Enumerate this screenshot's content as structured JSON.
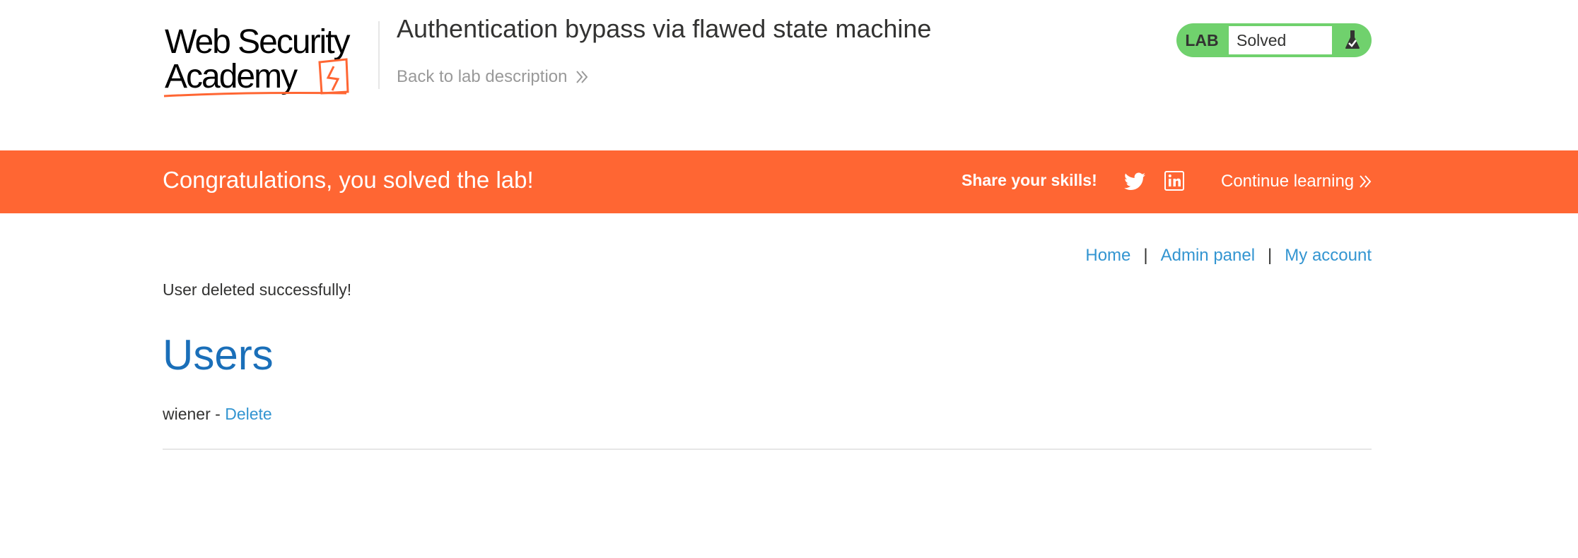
{
  "header": {
    "logo_line1": "Web Security",
    "logo_line2": "Academy",
    "lab_title": "Authentication bypass via flawed state machine",
    "back_link": "Back to lab description"
  },
  "lab_status": {
    "label": "LAB",
    "value": "Solved",
    "icon": "flask-check-icon",
    "color": "#70d16d"
  },
  "banner": {
    "message": "Congratulations, you solved the lab!",
    "share_label": "Share your skills!",
    "continue_link": "Continue learning",
    "color": "#ff6633"
  },
  "nav": {
    "items": [
      {
        "label": "Home"
      },
      {
        "label": "Admin panel"
      },
      {
        "label": "My account"
      }
    ],
    "separator": "|"
  },
  "main": {
    "message": "User deleted successfully!",
    "heading": "Users",
    "users": [
      {
        "name": "wiener",
        "separator": " - ",
        "action": "Delete"
      }
    ]
  }
}
